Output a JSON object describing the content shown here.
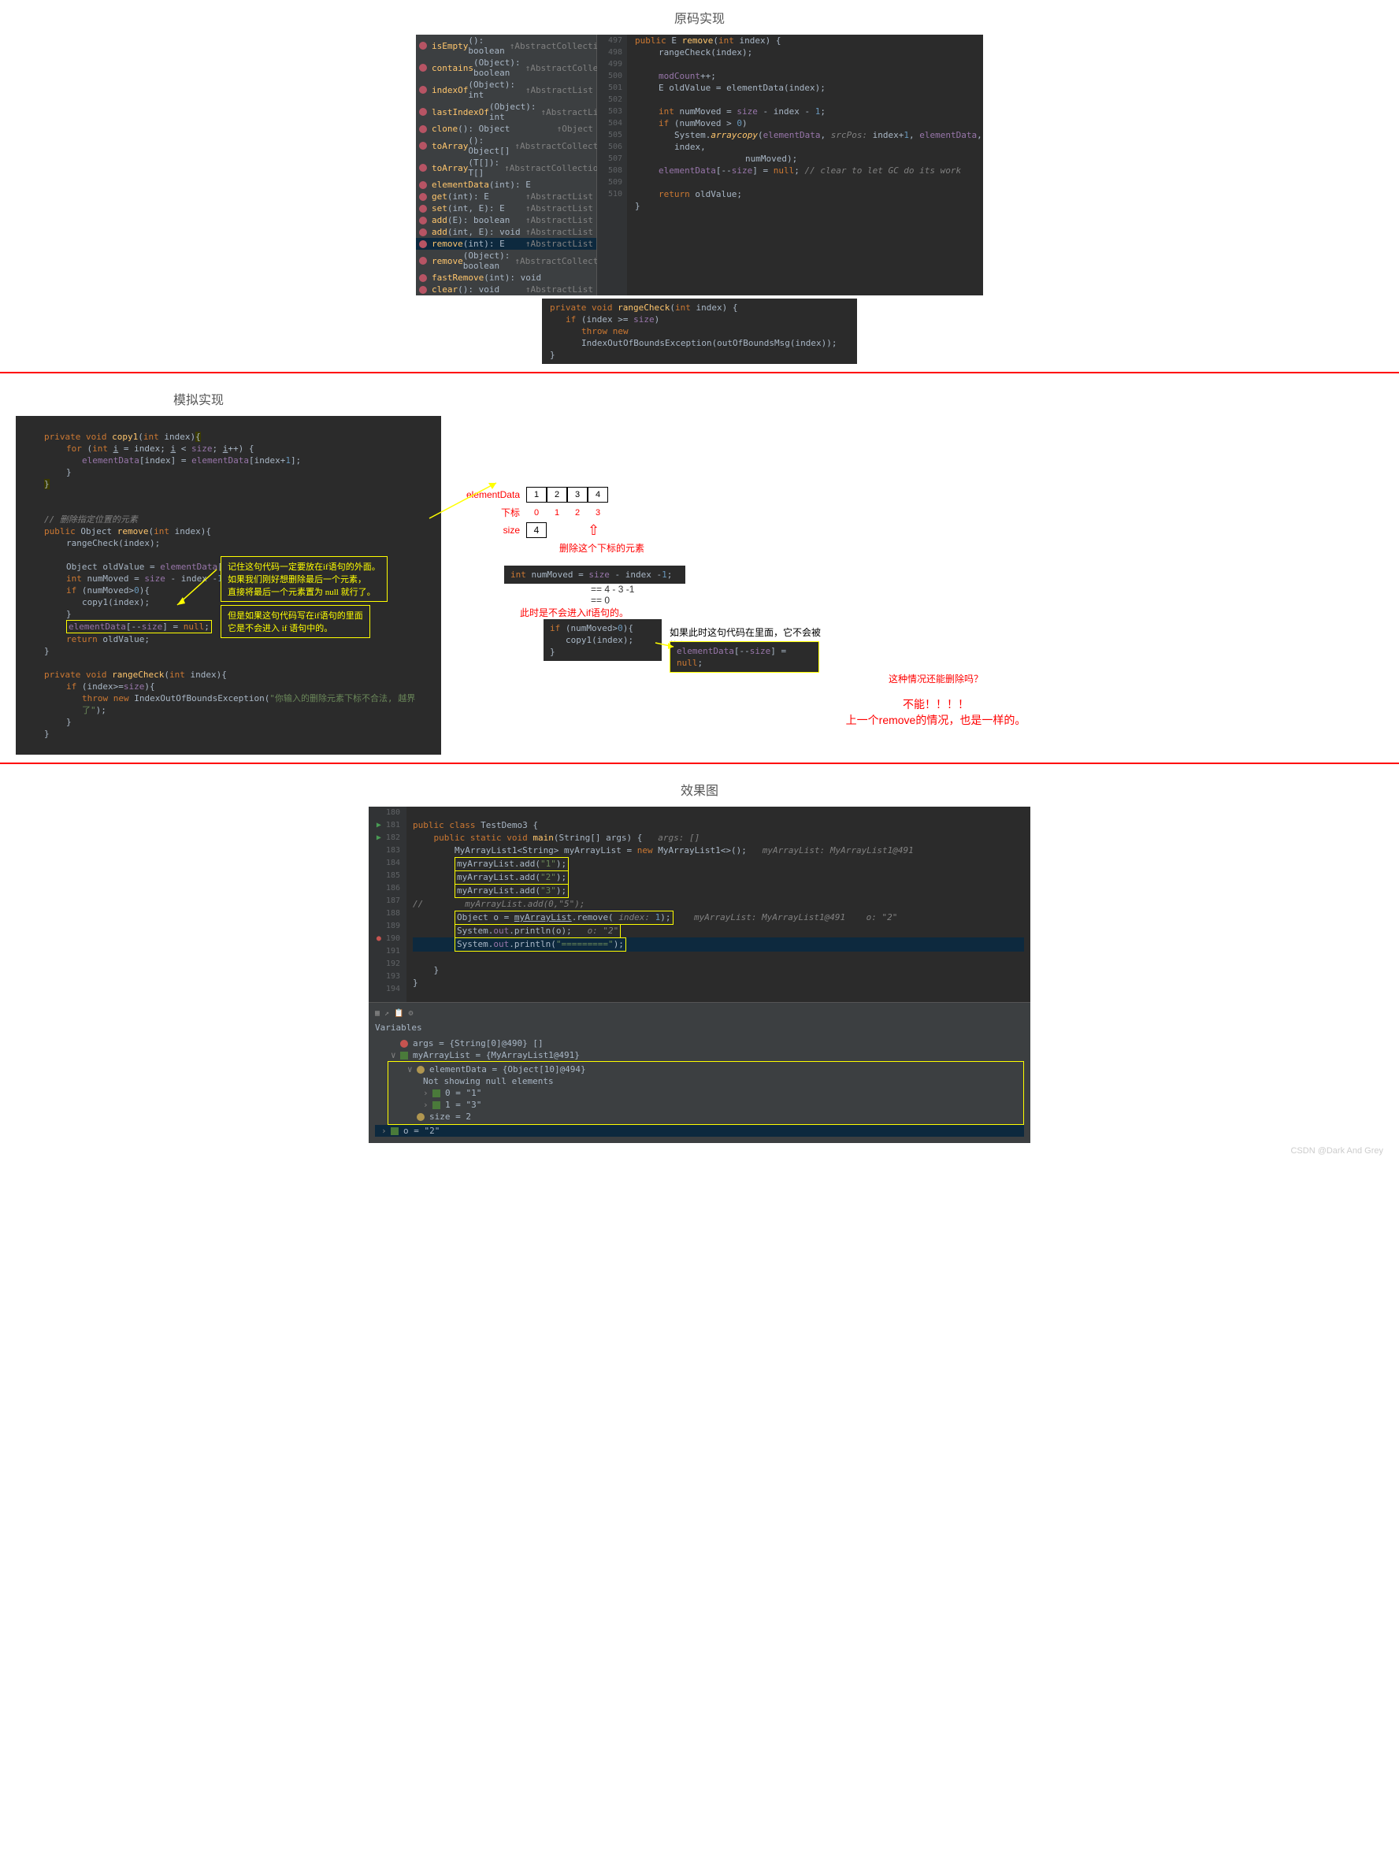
{
  "section1": {
    "title": "原码实现",
    "methods": [
      {
        "name": "isEmpty",
        "sig": "(): boolean",
        "ret": "↑AbstractCollection"
      },
      {
        "name": "contains",
        "sig": "(Object): boolean",
        "ret": "↑AbstractCollection"
      },
      {
        "name": "indexOf",
        "sig": "(Object): int",
        "ret": "↑AbstractList"
      },
      {
        "name": "lastIndexOf",
        "sig": "(Object): int",
        "ret": "↑AbstractList"
      },
      {
        "name": "clone",
        "sig": "(): Object",
        "ret": "↑Object"
      },
      {
        "name": "toArray",
        "sig": "(): Object[]",
        "ret": "↑AbstractCollection"
      },
      {
        "name": "toArray",
        "sig": "(T[]): T[]",
        "ret": "↑AbstractCollection"
      },
      {
        "name": "elementData",
        "sig": "(int): E",
        "ret": ""
      },
      {
        "name": "get",
        "sig": "(int): E",
        "ret": "↑AbstractList"
      },
      {
        "name": "set",
        "sig": "(int, E): E",
        "ret": "↑AbstractList"
      },
      {
        "name": "add",
        "sig": "(E): boolean",
        "ret": "↑AbstractList"
      },
      {
        "name": "add",
        "sig": "(int, E): void",
        "ret": "↑AbstractList"
      },
      {
        "name": "remove",
        "sig": "(int): E",
        "ret": "↑AbstractList",
        "sel": true
      },
      {
        "name": "remove",
        "sig": "(Object): boolean",
        "ret": "↑AbstractCollection"
      },
      {
        "name": "fastRemove",
        "sig": "(int): void",
        "ret": ""
      },
      {
        "name": "clear",
        "sig": "(): void",
        "ret": "↑AbstractList"
      }
    ],
    "lineStart": 497,
    "lineEnd": 510,
    "code": {
      "l497": "public E remove(int index) {",
      "l498": "rangeCheck(index);",
      "l500": "modCount++;",
      "l501": "E oldValue = elementData(index);",
      "l503": "int numMoved = size - index - 1;",
      "l504": "if (numMoved > 0)",
      "l505a": "System.arraycopy(elementData, ",
      "l505b": "srcPos:",
      "l505c": " index+1, elementData, index,",
      "l506": "numMoved);",
      "l507": "elementData[--size] = null;",
      "l507c": " // clear to let GC do its work",
      "l509": "return oldValue;",
      "l510": "}"
    },
    "rangeCheck": {
      "l1": "private void rangeCheck(int index) {",
      "l2": "if (index >= size)",
      "l3a": "throw new ",
      "l3b": "IndexOutOfBoundsException(outOfBoundsMsg(index));",
      "l4": "}"
    }
  },
  "section2": {
    "title": "模拟实现",
    "code": {
      "copy1_sig": "private void copy1(int index){",
      "for_line": "for (int i = index; i < size; i++) {",
      "assign": "elementData[index] = elementData[index+1];",
      "comment1": "// 删除指定位置的元素",
      "remove_sig": "public Object remove(int index){",
      "rc": "rangeCheck(index);",
      "ov": "Object oldValue = elementData[index];",
      "nm": "int numMoved = size - index -1;",
      "if": "if (numMoved>0){",
      "cp": "copy1(index);",
      "ed": "elementData[--size] = null;",
      "ret": "return  oldValue;",
      "rc_sig": "private void rangeCheck(int index){",
      "rc_if": "if (index>=size){",
      "rc_throw": "throw new IndexOutOfBoundsException(\"你输入的删除元素下标不合法, 越界了\");"
    },
    "note1_l1": "记住这句代码一定要放在if语句的外面。",
    "note1_l2": "如果我们刚好想删除最后一个元素，",
    "note1_l3": "直接将最后一个元素置为 null 就行了。",
    "note2_l1": "但是如果这句代码写在if语句的里面",
    "note2_l2": "它是不会进入 if 语句中的。",
    "diagram": {
      "label_ed": "elementData",
      "cells": [
        "1",
        "2",
        "3",
        "4"
      ],
      "label_idx": "下标",
      "indices": [
        "0",
        "1",
        "2",
        "3"
      ],
      "label_size": "size",
      "size_val": "4",
      "del_note": "删除这个下标的元素",
      "calc_l1": "int numMoved = size - index -1;",
      "calc_l2": "== 4 - 3 -1",
      "calc_l3": "== 0",
      "no_enter": "此时是不会进入if语句的。",
      "inner_if": "if (numMoved>0){",
      "inner_cp": "copy1(index);",
      "inner_note": "如果此时这句代码在里面，它不会被执行",
      "inner_ed": "elementData[--size] = null;",
      "q": "这种情况还能删除吗？",
      "a1": "不能！！！！",
      "a2": "上一个remove的情况，也是一样的。"
    }
  },
  "section3": {
    "title": "效果图",
    "lineStart": 180,
    "lines": {
      "l181": "public class TestDemo3 {",
      "l182a": "public static void main(String[] args) {",
      "l182b": "args: []",
      "l183a": "MyArrayList1<String> myArrayList = new MyArrayList1<>();",
      "l183b": "myArrayList: MyArrayList1@491",
      "l184": "myArrayList.add(\"1\");",
      "l185": "myArrayList.add(\"2\");",
      "l186": "myArrayList.add(\"3\");",
      "l187": "//        myArrayList.add(0,\"5\");",
      "l188a": "Object o = myArrayList.remove(",
      "l188b": "index: ",
      "l188c": "1);",
      "l188d": "myArrayList: MyArrayList1@491    o: \"2\"",
      "l189a": "System.out.println(o);",
      "l189b": "o: \"2\"",
      "l190": "System.out.println(\"=========\");",
      "l192": "}",
      "l193": "}"
    },
    "variables": {
      "title": "Variables",
      "args": "args = {String[0]@490} []",
      "mal": "myArrayList = {MyArrayList1@491}",
      "ed": "elementData = {Object[10]@494}",
      "notnull": "Not showing null elements",
      "e0": "0 = \"1\"",
      "e1": "1 = \"3\"",
      "size": "size = 2",
      "o": "o = \"2\""
    }
  },
  "watermark": "CSDN @Dark And Grey"
}
